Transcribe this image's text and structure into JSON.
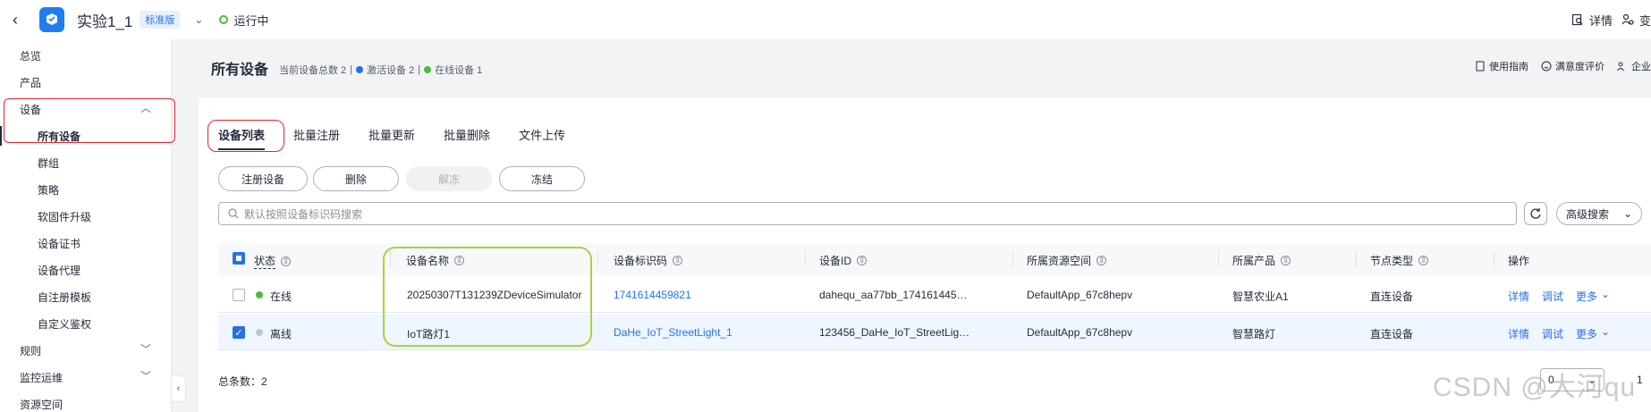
{
  "topbar": {
    "back_icon": "chevron-left-icon",
    "app_title": "实验1_1",
    "edition": "标准版",
    "status": "运行中",
    "status_color": "#50b83c",
    "links": [
      "详情",
      "变"
    ]
  },
  "sidebar": {
    "items": [
      {
        "label": "总览"
      },
      {
        "label": "产品"
      },
      {
        "label": "设备",
        "expanded": true
      },
      {
        "label": "规则"
      },
      {
        "label": "监控运维"
      },
      {
        "label": "资源空间"
      }
    ],
    "device_children": [
      "所有设备",
      "群组",
      "策略",
      "软固件升级",
      "设备证书",
      "设备代理",
      "自注册模板",
      "自定义鉴权"
    ],
    "active_child": "所有设备"
  },
  "header": {
    "title": "所有设备",
    "stat_total": "当前设备总数 2",
    "stat_active": "激活设备 2",
    "stat_online": "在线设备 1",
    "active_color": "#2670e8",
    "online_color": "#50b83c",
    "links": [
      "使用指南",
      "满意度评价",
      "企业"
    ]
  },
  "tabs": [
    "设备列表",
    "批量注册",
    "批量更新",
    "批量删除",
    "文件上传"
  ],
  "active_tab": "设备列表",
  "actions": {
    "register": "注册设备",
    "delete": "删除",
    "unfreeze": "解冻",
    "freeze": "冻结"
  },
  "search": {
    "placeholder": "默认按照设备标识码搜索",
    "advanced": "高级搜索"
  },
  "table": {
    "headers": [
      "状态",
      "设备名称",
      "设备标识码",
      "设备ID",
      "所属资源空间",
      "所属产品",
      "节点类型",
      "操作"
    ],
    "rows": [
      {
        "selected": false,
        "status": "在线",
        "status_color": "#50b83c",
        "name": "20250307T131239ZDeviceSimulator",
        "identifier": "1741614459821",
        "device_id": "dahequ_aa77bb_174161445…",
        "space": "DefaultApp_67c8hepv",
        "product": "智慧农业A1",
        "node_type": "直连设备",
        "ops": [
          "详情",
          "调试",
          "更多"
        ]
      },
      {
        "selected": true,
        "status": "离线",
        "status_color": "#c2c4c9",
        "name": "IoT路灯1",
        "identifier": "DaHe_IoT_StreetLight_1",
        "device_id": "123456_DaHe_IoT_StreetLig…",
        "space": "DefaultApp_67c8hepv",
        "product": "智慧路灯",
        "node_type": "直连设备",
        "ops": [
          "详情",
          "调试",
          "更多"
        ]
      }
    ]
  },
  "footer": {
    "total": "总条数：2",
    "page_size": "0",
    "page": "1"
  },
  "watermark": "CSDN @大河qu"
}
